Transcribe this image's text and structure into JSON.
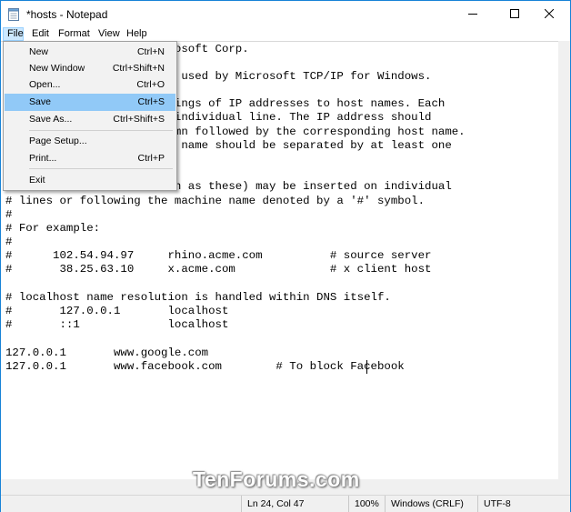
{
  "window": {
    "title": "*hosts - Notepad",
    "accent": "#1883d7"
  },
  "caption_buttons": {
    "minimize": "minimize-icon",
    "maximize": "maximize-icon",
    "close": "close-icon"
  },
  "menubar": {
    "file": "File",
    "edit": "Edit",
    "format": "Format",
    "view": "View",
    "help": "Help"
  },
  "file_menu": {
    "items": [
      {
        "label": "New",
        "accel": "Ctrl+N"
      },
      {
        "label": "New Window",
        "accel": "Ctrl+Shift+N"
      },
      {
        "label": "Open...",
        "accel": "Ctrl+O"
      },
      {
        "label": "Save",
        "accel": "Ctrl+S"
      },
      {
        "label": "Save As...",
        "accel": "Ctrl+Shift+S"
      },
      {
        "label": "Page Setup...",
        "accel": ""
      },
      {
        "label": "Print...",
        "accel": "Ctrl+P"
      },
      {
        "label": "Exit",
        "accel": ""
      }
    ],
    "highlighted": "Save"
  },
  "editor": {
    "lines": [
      "                        rosoft Corp.",
      "",
      "                        e used by Microsoft TCP/IP for Windows.",
      "",
      "                        pings of IP addresses to host names. Each",
      "                         individual line. The IP address should",
      "                        umn followed by the corresponding host name.",
      "                        t name should be separated by at least one",
      "",
      "",
      "                        ch as these) may be inserted on individual",
      "# lines or following the machine name denoted by a '#' symbol.",
      "#",
      "# For example:",
      "#",
      "#      102.54.94.97     rhino.acme.com          # source server",
      "#       38.25.63.10     x.acme.com              # x client host",
      "",
      "# localhost name resolution is handled within DNS itself.",
      "#       127.0.0.1       localhost",
      "#       ::1             localhost",
      "",
      "127.0.0.1       www.google.com",
      "127.0.0.1       www.facebook.com        # To block Facebook"
    ]
  },
  "statusbar": {
    "position": "Ln 24, Col 47",
    "zoom": "100%",
    "line_endings": "Windows (CRLF)",
    "encoding": "UTF-8"
  },
  "watermark": "TenForums.com"
}
